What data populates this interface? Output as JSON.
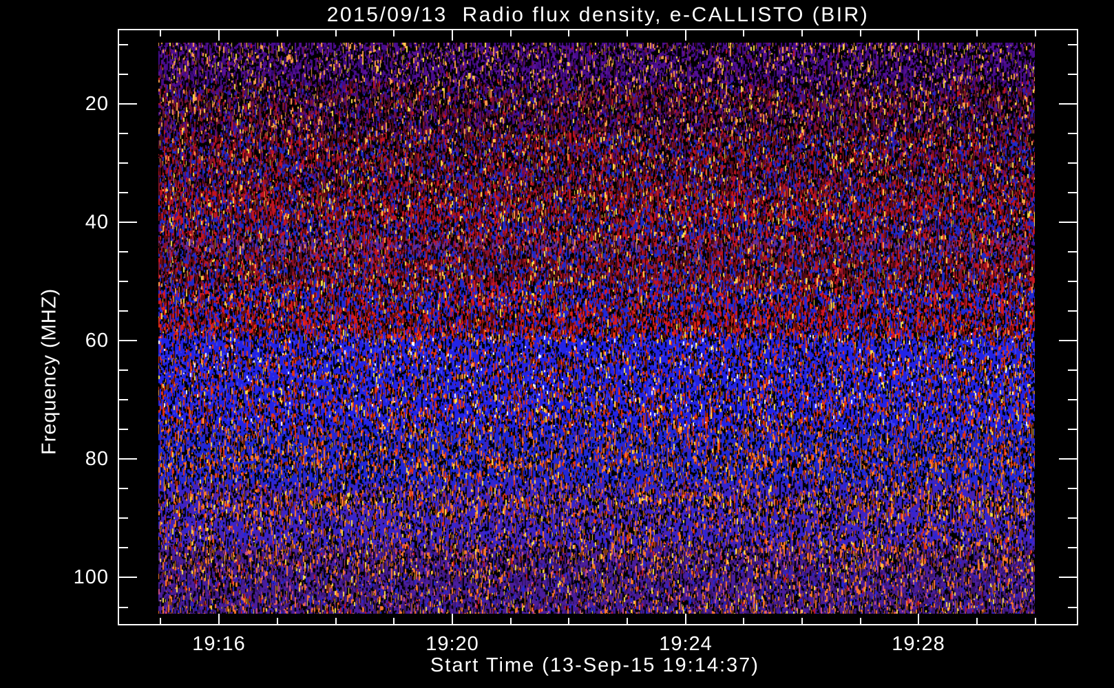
{
  "page": {
    "background": "#000000",
    "foreground": "#ffffff"
  },
  "chart_data": {
    "type": "heatmap",
    "title": "2015/09/13  Radio flux density, e-CALLISTO (BIR)",
    "date": "2015/09/13",
    "instrument": "e-CALLISTO",
    "station": "BIR",
    "xlabel": "Start Time (13-Sep-15 19:14:37)",
    "ylabel": "Frequency (MHZ)",
    "grid": false,
    "legend": "none",
    "y_axis": {
      "unit": "MHz",
      "range_mhz": [
        9.7,
        106.1
      ],
      "increases_downward": true,
      "major_tick_values": [
        20,
        40,
        60,
        80,
        100
      ],
      "major_tick_labels": [
        "20",
        "40",
        "60",
        "80",
        "100"
      ],
      "minor_tick_values": [
        10,
        15,
        25,
        30,
        35,
        45,
        50,
        55,
        65,
        70,
        75,
        85,
        90,
        95,
        105
      ]
    },
    "x_axis": {
      "start_time_label": "19:14:37",
      "major_ticks": [
        {
          "minute_offset": 0,
          "label": "19:16"
        },
        {
          "minute_offset": 4,
          "label": "19:20"
        },
        {
          "minute_offset": 8,
          "label": "19:24"
        },
        {
          "minute_offset": 12,
          "label": "19:28"
        }
      ],
      "minor_tick_minute_offsets": [
        -1,
        1,
        2,
        3,
        5,
        6,
        7,
        9,
        10,
        11,
        13,
        14
      ],
      "zero_frac": 0.1055,
      "frac_per_minute": 0.0607
    },
    "bands": [
      {
        "from_mhz": 9.7,
        "to_mhz": 16.1,
        "desc": "dark violet noise, sparse orange speckles",
        "stripe": 0.25,
        "palette": [
          {
            "c": "#000000",
            "w": 0.38
          },
          {
            "c": "#470b8c",
            "w": 0.26
          },
          {
            "c": "#5a1199",
            "w": 0.12
          },
          {
            "c": "#2e0765",
            "w": 0.07
          },
          {
            "c": "#ff9f4a",
            "w": 0.1
          },
          {
            "c": "#6e1240",
            "w": 0.04
          },
          {
            "c": "#ffe14a",
            "w": 0.02
          },
          {
            "c": "#c41420",
            "w": 0.01
          }
        ]
      },
      {
        "from_mhz": 16.1,
        "to_mhz": 24.8,
        "desc": "violet-maroon mix",
        "stripe": 0.3,
        "palette": [
          {
            "c": "#000000",
            "w": 0.33
          },
          {
            "c": "#470b8c",
            "w": 0.18
          },
          {
            "c": "#6e1240",
            "w": 0.16
          },
          {
            "c": "#8a1228",
            "w": 0.1
          },
          {
            "c": "#ff9f4a",
            "w": 0.07
          },
          {
            "c": "#c41420",
            "w": 0.05
          },
          {
            "c": "#1f2ac8",
            "w": 0.05
          },
          {
            "c": "#2e0765",
            "w": 0.04
          },
          {
            "c": "#ffe14a",
            "w": 0.02
          }
        ]
      },
      {
        "from_mhz": 24.8,
        "to_mhz": 34.7,
        "desc": "maroon/red interference with blue",
        "stripe": 0.45,
        "palette": [
          {
            "c": "#000000",
            "w": 0.26
          },
          {
            "c": "#8a1228",
            "w": 0.19
          },
          {
            "c": "#c41420",
            "w": 0.16
          },
          {
            "c": "#1f2ac8",
            "w": 0.16
          },
          {
            "c": "#470b8c",
            "w": 0.07
          },
          {
            "c": "#ff9f4a",
            "w": 0.05
          },
          {
            "c": "#ffe14a",
            "w": 0.03
          },
          {
            "c": "#4a0c38",
            "w": 0.05
          }
        ]
      },
      {
        "from_mhz": 34.7,
        "to_mhz": 42.8,
        "desc": "red and blue banded noise",
        "stripe": 0.5,
        "palette": [
          {
            "c": "#c41420",
            "w": 0.29
          },
          {
            "c": "#1f2ac8",
            "w": 0.25
          },
          {
            "c": "#000000",
            "w": 0.21
          },
          {
            "c": "#8a1228",
            "w": 0.1
          },
          {
            "c": "#ffe14a",
            "w": 0.04
          },
          {
            "c": "#ff9f4a",
            "w": 0.04
          },
          {
            "c": "#470b8c",
            "w": 0.04
          }
        ]
      },
      {
        "from_mhz": 42.8,
        "to_mhz": 44.5,
        "desc": "narrow purple stripe",
        "stripe": 0.3,
        "palette": [
          {
            "c": "#6b2f94",
            "w": 0.27
          },
          {
            "c": "#000000",
            "w": 0.22
          },
          {
            "c": "#8a1228",
            "w": 0.15
          },
          {
            "c": "#c41420",
            "w": 0.12
          },
          {
            "c": "#1f2ac8",
            "w": 0.12
          },
          {
            "c": "#ff9f4a",
            "w": 0.05
          },
          {
            "c": "#470b8c",
            "w": 0.05
          }
        ]
      },
      {
        "from_mhz": 44.5,
        "to_mhz": 50.3,
        "desc": "dark red band",
        "stripe": 0.5,
        "palette": [
          {
            "c": "#8a1228",
            "w": 0.25
          },
          {
            "c": "#c41420",
            "w": 0.22
          },
          {
            "c": "#1f2ac8",
            "w": 0.21
          },
          {
            "c": "#000000",
            "w": 0.2
          },
          {
            "c": "#ffe14a",
            "w": 0.04
          },
          {
            "c": "#ff9f4a",
            "w": 0.03
          },
          {
            "c": "#6b2f94",
            "w": 0.03
          }
        ]
      },
      {
        "from_mhz": 50.3,
        "to_mhz": 54.1,
        "desc": "bright red over blue",
        "stripe": 0.65,
        "palette": [
          {
            "c": "#d8181e",
            "w": 0.31
          },
          {
            "c": "#2028d8",
            "w": 0.27
          },
          {
            "c": "#000000",
            "w": 0.2
          },
          {
            "c": "#8a1228",
            "w": 0.09
          },
          {
            "c": "#ff9f4a",
            "w": 0.06
          },
          {
            "c": "#ffe14a",
            "w": 0.04
          }
        ]
      },
      {
        "from_mhz": 54.1,
        "to_mhz": 58.5,
        "desc": "red to blue transition rows",
        "stripe": 0.65,
        "palette": [
          {
            "c": "#2028d8",
            "w": 0.35
          },
          {
            "c": "#d8181e",
            "w": 0.25
          },
          {
            "c": "#000000",
            "w": 0.23
          },
          {
            "c": "#e5330f",
            "w": 0.08
          },
          {
            "c": "#8a1228",
            "w": 0.05
          },
          {
            "c": "#ffe14a",
            "w": 0.02
          }
        ]
      },
      {
        "from_mhz": 58.5,
        "to_mhz": 74.7,
        "desc": "bright blue with red speckles",
        "stripe": 0.3,
        "palette": [
          {
            "c": "#2323e6",
            "w": 0.49
          },
          {
            "c": "#e5330f",
            "w": 0.15
          },
          {
            "c": "#000000",
            "w": 0.21
          },
          {
            "c": "#3c42f0",
            "w": 0.06
          },
          {
            "c": "#ffe14a",
            "w": 0.03
          },
          {
            "c": "#ff9f4a",
            "w": 0.03
          },
          {
            "c": "#ffffff",
            "w": 0.01
          }
        ]
      },
      {
        "from_mhz": 74.7,
        "to_mhz": 84.0,
        "desc": "blue with orange speckles",
        "stripe": 0.3,
        "palette": [
          {
            "c": "#2028d8",
            "w": 0.45
          },
          {
            "c": "#000000",
            "w": 0.23
          },
          {
            "c": "#ff7a2a",
            "w": 0.12
          },
          {
            "c": "#e5330f",
            "w": 0.09
          },
          {
            "c": "#4f22a8",
            "w": 0.06
          },
          {
            "c": "#ffe14a",
            "w": 0.02
          }
        ]
      },
      {
        "from_mhz": 84.0,
        "to_mhz": 94.5,
        "desc": "blue-violet noise",
        "stripe": 0.3,
        "palette": [
          {
            "c": "#3a24cc",
            "w": 0.37
          },
          {
            "c": "#4f22a8",
            "w": 0.16
          },
          {
            "c": "#000000",
            "w": 0.22
          },
          {
            "c": "#ff7a2a",
            "w": 0.12
          },
          {
            "c": "#e5330f",
            "w": 0.05
          },
          {
            "c": "#ffe14a",
            "w": 0.03
          },
          {
            "c": "#2028d8",
            "w": 0.03
          }
        ]
      },
      {
        "from_mhz": 94.5,
        "to_mhz": 106.1,
        "desc": "violet noise with orange speckles",
        "stripe": 0.3,
        "palette": [
          {
            "c": "#4a1d9c",
            "w": 0.35
          },
          {
            "c": "#38156e",
            "w": 0.19
          },
          {
            "c": "#000000",
            "w": 0.22
          },
          {
            "c": "#ff7a2a",
            "w": 0.11
          },
          {
            "c": "#2028d8",
            "w": 0.05
          },
          {
            "c": "#d4508a",
            "w": 0.03
          },
          {
            "c": "#ffe14a",
            "w": 0.03
          },
          {
            "c": "#c41420",
            "w": 0.02
          }
        ]
      }
    ]
  }
}
